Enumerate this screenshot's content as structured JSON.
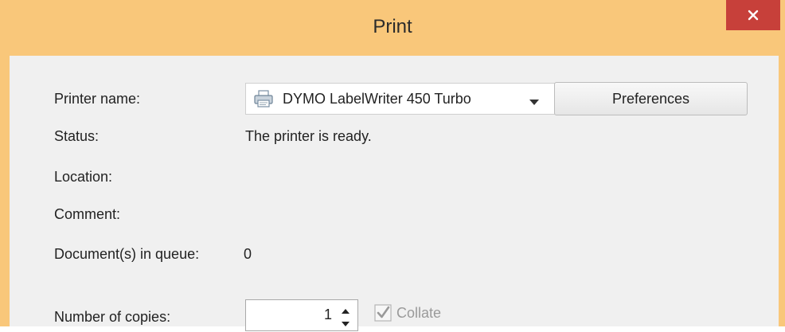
{
  "window": {
    "title": "Print"
  },
  "printer": {
    "name_label": "Printer name:",
    "selected": "DYMO LabelWriter 450 Turbo",
    "preferences_label": "Preferences"
  },
  "status": {
    "label": "Status:",
    "value": "The printer is ready."
  },
  "location": {
    "label": "Location:",
    "value": ""
  },
  "comment": {
    "label": "Comment:",
    "value": ""
  },
  "queue": {
    "label": "Document(s) in queue:",
    "value": "0"
  },
  "copies": {
    "label": "Number of copies:",
    "value": "1",
    "collate_label": "Collate",
    "collate_checked": true
  },
  "icons": {
    "close": "close-icon",
    "printer": "printer-icon",
    "dropdown": "chevron-down-icon",
    "spin_up": "spin-up-icon",
    "spin_down": "spin-down-icon",
    "checkbox": "checkbox-icon"
  },
  "colors": {
    "titlebar": "#f9c77a",
    "close_button": "#c7403a",
    "content_bg": "#f0f0f0",
    "disabled_text": "#9a9a9a"
  }
}
